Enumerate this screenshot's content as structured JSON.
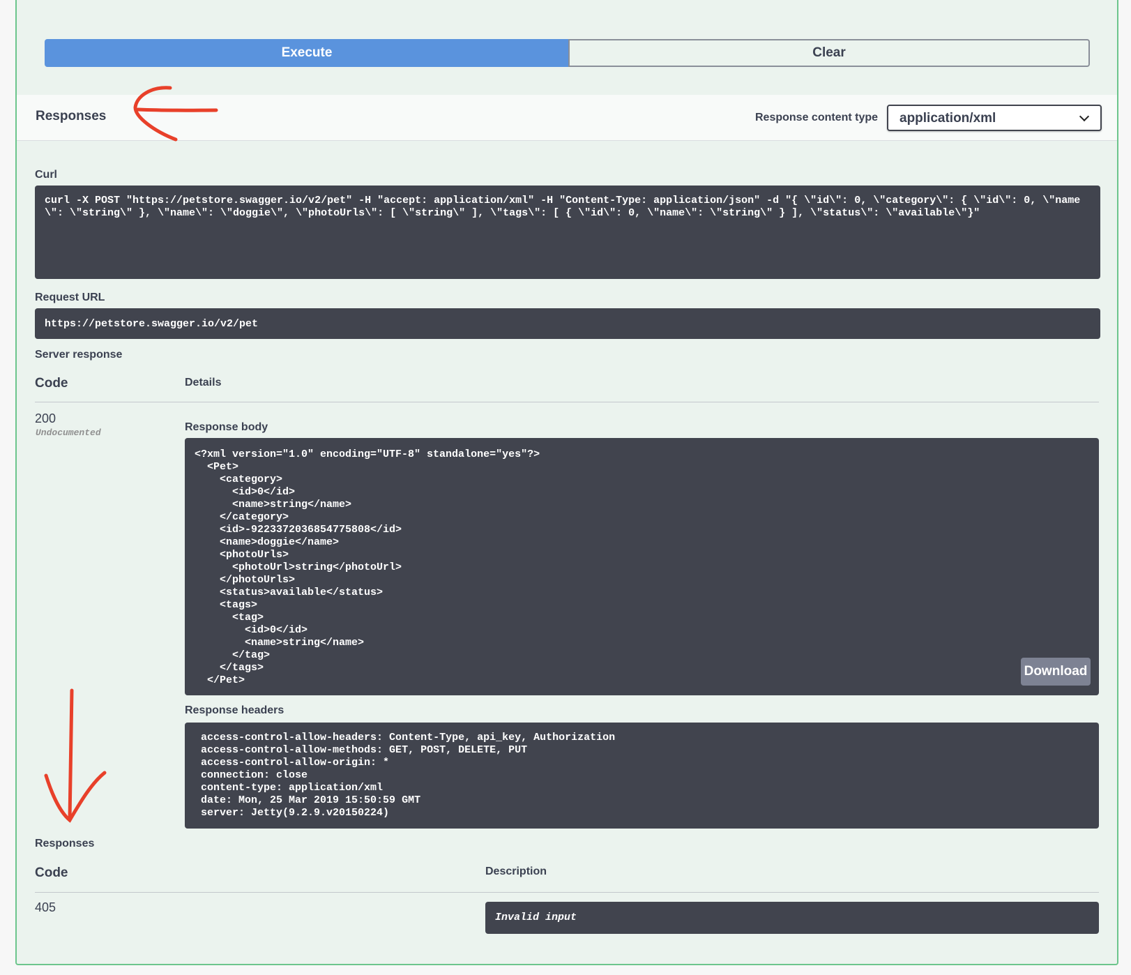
{
  "buttons": {
    "execute": "Execute",
    "clear": "Clear"
  },
  "responses_header": {
    "title": "Responses",
    "content_type_label": "Response content type",
    "content_type_value": "application/xml"
  },
  "curl": {
    "label": "Curl",
    "command": "curl -X POST \"https://petstore.swagger.io/v2/pet\" -H \"accept: application/xml\" -H \"Content-Type: application/json\" -d \"{ \\\"id\\\": 0, \\\"category\\\": { \\\"id\\\": 0, \\\"name\\\": \\\"string\\\" }, \\\"name\\\": \\\"doggie\\\", \\\"photoUrls\\\": [ \\\"string\\\" ], \\\"tags\\\": [ { \\\"id\\\": 0, \\\"name\\\": \\\"string\\\" } ], \\\"status\\\": \\\"available\\\"}\""
  },
  "request_url": {
    "label": "Request URL",
    "value": "https://petstore.swagger.io/v2/pet"
  },
  "server_response": {
    "label": "Server response",
    "col_code": "Code",
    "col_details": "Details",
    "code": "200",
    "code_note": "Undocumented",
    "body_label": "Response body",
    "body": "<?xml version=\"1.0\" encoding=\"UTF-8\" standalone=\"yes\"?>\n  <Pet>\n    <category>\n      <id>0</id>\n      <name>string</name>\n    </category>\n    <id>-9223372036854775808</id>\n    <name>doggie</name>\n    <photoUrls>\n      <photoUrl>string</photoUrl>\n    </photoUrls>\n    <status>available</status>\n    <tags>\n      <tag>\n        <id>0</id>\n        <name>string</name>\n      </tag>\n    </tags>\n  </Pet>",
    "download_label": "Download",
    "headers_label": "Response headers",
    "headers": " access-control-allow-headers: Content-Type, api_key, Authorization\n access-control-allow-methods: GET, POST, DELETE, PUT\n access-control-allow-origin: *\n connection: close\n content-type: application/xml\n date: Mon, 25 Mar 2019 15:50:59 GMT\n server: Jetty(9.2.9.v20150224)"
  },
  "responses": {
    "label": "Responses",
    "col_code": "Code",
    "col_description": "Description",
    "code": "405",
    "description": "Invalid input"
  },
  "colors": {
    "execute": "#5a93dd",
    "panel_bg": "#ebf3ee",
    "panel_border": "#6cc58c",
    "code_bg": "#41444e",
    "annotation": "#e8402a"
  }
}
